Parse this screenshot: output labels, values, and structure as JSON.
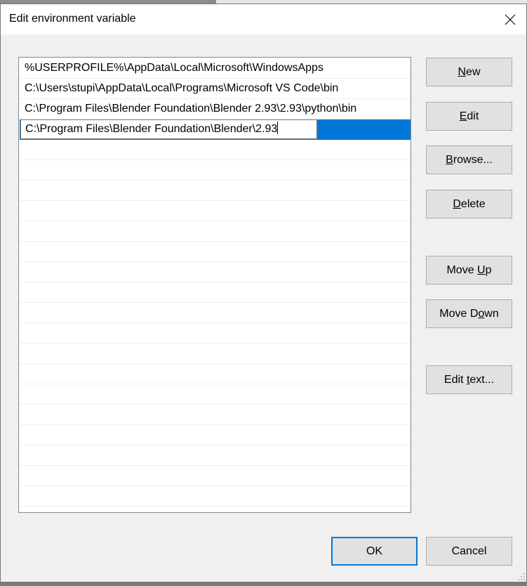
{
  "dialog": {
    "title": "Edit environment variable",
    "close_icon": "close-icon"
  },
  "list": {
    "items": [
      "%USERPROFILE%\\AppData\\Local\\Microsoft\\WindowsApps",
      "C:\\Users\\stupi\\AppData\\Local\\Programs\\Microsoft VS Code\\bin",
      "C:\\Program Files\\Blender Foundation\\Blender 2.93\\2.93\\python\\bin"
    ],
    "editing_value": "C:\\Program Files\\Blender Foundation\\Blender\\2.93",
    "empty_rows": 18,
    "selection_color": "#0078d7"
  },
  "buttons": {
    "new": {
      "pre": "",
      "key": "N",
      "post": "ew"
    },
    "edit": {
      "pre": "",
      "key": "E",
      "post": "dit"
    },
    "browse": {
      "pre": "",
      "key": "B",
      "post": "rowse..."
    },
    "delete": {
      "pre": "",
      "key": "D",
      "post": "elete"
    },
    "move_up": {
      "pre": "Move ",
      "key": "U",
      "post": "p"
    },
    "move_down": {
      "pre": "Move D",
      "key": "o",
      "post": "wn"
    },
    "edit_text": {
      "pre": "Edit ",
      "key": "t",
      "post": "ext..."
    },
    "ok": "OK",
    "cancel": "Cancel"
  }
}
